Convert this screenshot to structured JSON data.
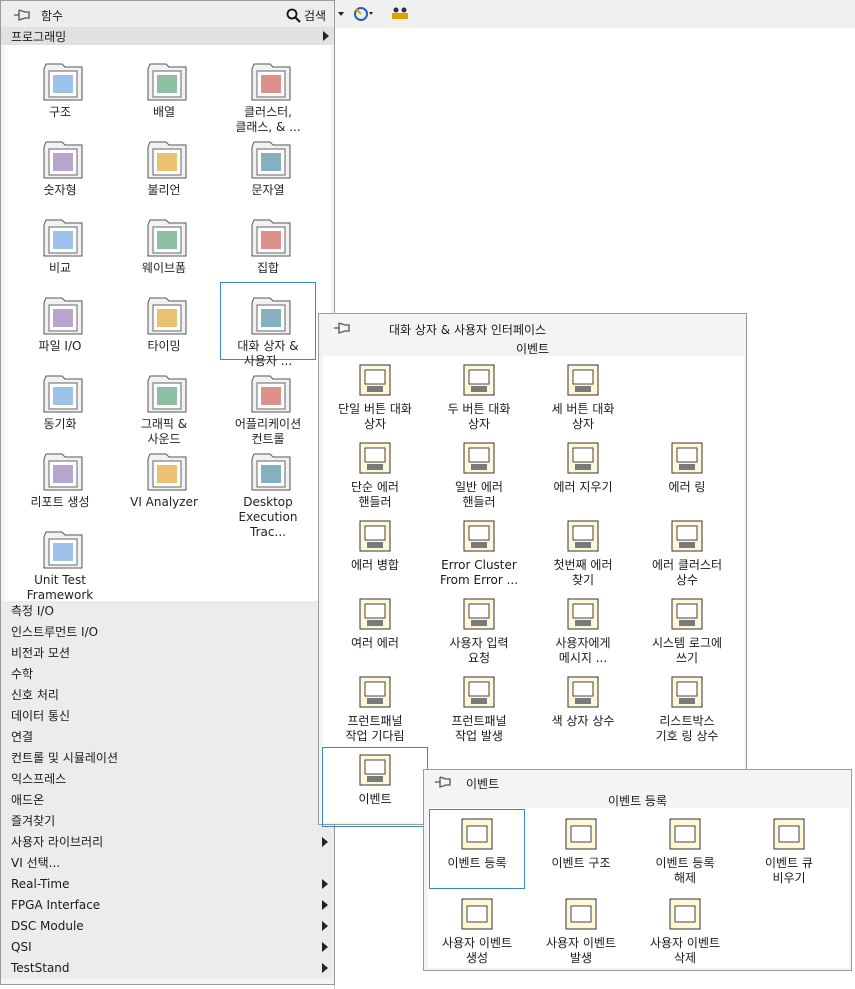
{
  "palette": {
    "title": "함수",
    "search_label": "검색",
    "category_header": "프로그래밍",
    "tiles": [
      {
        "label": "구조"
      },
      {
        "label": "배열"
      },
      {
        "label": "클러스터,\n클래스, & ..."
      },
      {
        "label": "숫자형"
      },
      {
        "label": "불리언"
      },
      {
        "label": "문자열"
      },
      {
        "label": "비교"
      },
      {
        "label": "웨이브폼"
      },
      {
        "label": "집합"
      },
      {
        "label": "파일 I/O"
      },
      {
        "label": "타이밍"
      },
      {
        "label": "대화 상자 &\n사용자 ..."
      },
      {
        "label": "동기화"
      },
      {
        "label": "그래픽 &\n사운드"
      },
      {
        "label": "어플리케이션\n컨트롤"
      },
      {
        "label": "리포트 생성"
      },
      {
        "label": "VI Analyzer"
      },
      {
        "label": "Desktop\nExecution Trac..."
      },
      {
        "label": "Unit Test\nFramework"
      }
    ],
    "categories": [
      {
        "label": "측정 I/O"
      },
      {
        "label": "인스트루먼트 I/O"
      },
      {
        "label": "비전과 모션"
      },
      {
        "label": "수학"
      },
      {
        "label": "신호 처리"
      },
      {
        "label": "데이터 통신"
      },
      {
        "label": "연결"
      },
      {
        "label": "컨트롤 및 시뮬레이션"
      },
      {
        "label": "익스프레스"
      },
      {
        "label": "애드온"
      },
      {
        "label": "즐겨찾기"
      },
      {
        "label": "사용자 라이브러리"
      },
      {
        "label": "VI 선택..."
      },
      {
        "label": "Real-Time"
      },
      {
        "label": "FPGA Interface"
      },
      {
        "label": "DSC Module"
      },
      {
        "label": "QSI"
      },
      {
        "label": "TestStand"
      }
    ]
  },
  "dialog_palette": {
    "title": "대화 상자 & 사용자 인터페이스",
    "group": "이벤트",
    "tiles": [
      {
        "label": "단일 버튼 대화\n상자"
      },
      {
        "label": "두 버튼 대화\n상자"
      },
      {
        "label": "세 버튼 대화\n상자"
      },
      {
        "label": ""
      },
      {
        "label": "단순 에러\n핸들러"
      },
      {
        "label": "일반 에러\n핸들러"
      },
      {
        "label": "에러 지우기"
      },
      {
        "label": "에러 링"
      },
      {
        "label": "에러 병합"
      },
      {
        "label": "Error Cluster\nFrom Error ..."
      },
      {
        "label": "첫번째 에러\n찾기"
      },
      {
        "label": "에러 클러스터\n상수"
      },
      {
        "label": "여러 에러"
      },
      {
        "label": "사용자 입력\n요청"
      },
      {
        "label": "사용자에게\n메시지 ..."
      },
      {
        "label": "시스템 로그에\n쓰기"
      },
      {
        "label": "프런트패널\n작업 기다림"
      },
      {
        "label": "프런트패널\n작업 발생"
      },
      {
        "label": "색 상자 상수"
      },
      {
        "label": "리스트박스\n기호 링 상수"
      },
      {
        "label": "이벤트"
      }
    ]
  },
  "events_palette": {
    "title": "이벤트",
    "group": "이벤트 등록",
    "tiles": [
      {
        "label": "이벤트 등록"
      },
      {
        "label": "이벤트 구조"
      },
      {
        "label": "이벤트 등록\n해제"
      },
      {
        "label": "이벤트 큐\n비우기"
      },
      {
        "label": "사용자 이벤트\n생성"
      },
      {
        "label": "사용자 이벤트\n발생"
      },
      {
        "label": "사용자 이벤트\n삭제"
      }
    ]
  }
}
